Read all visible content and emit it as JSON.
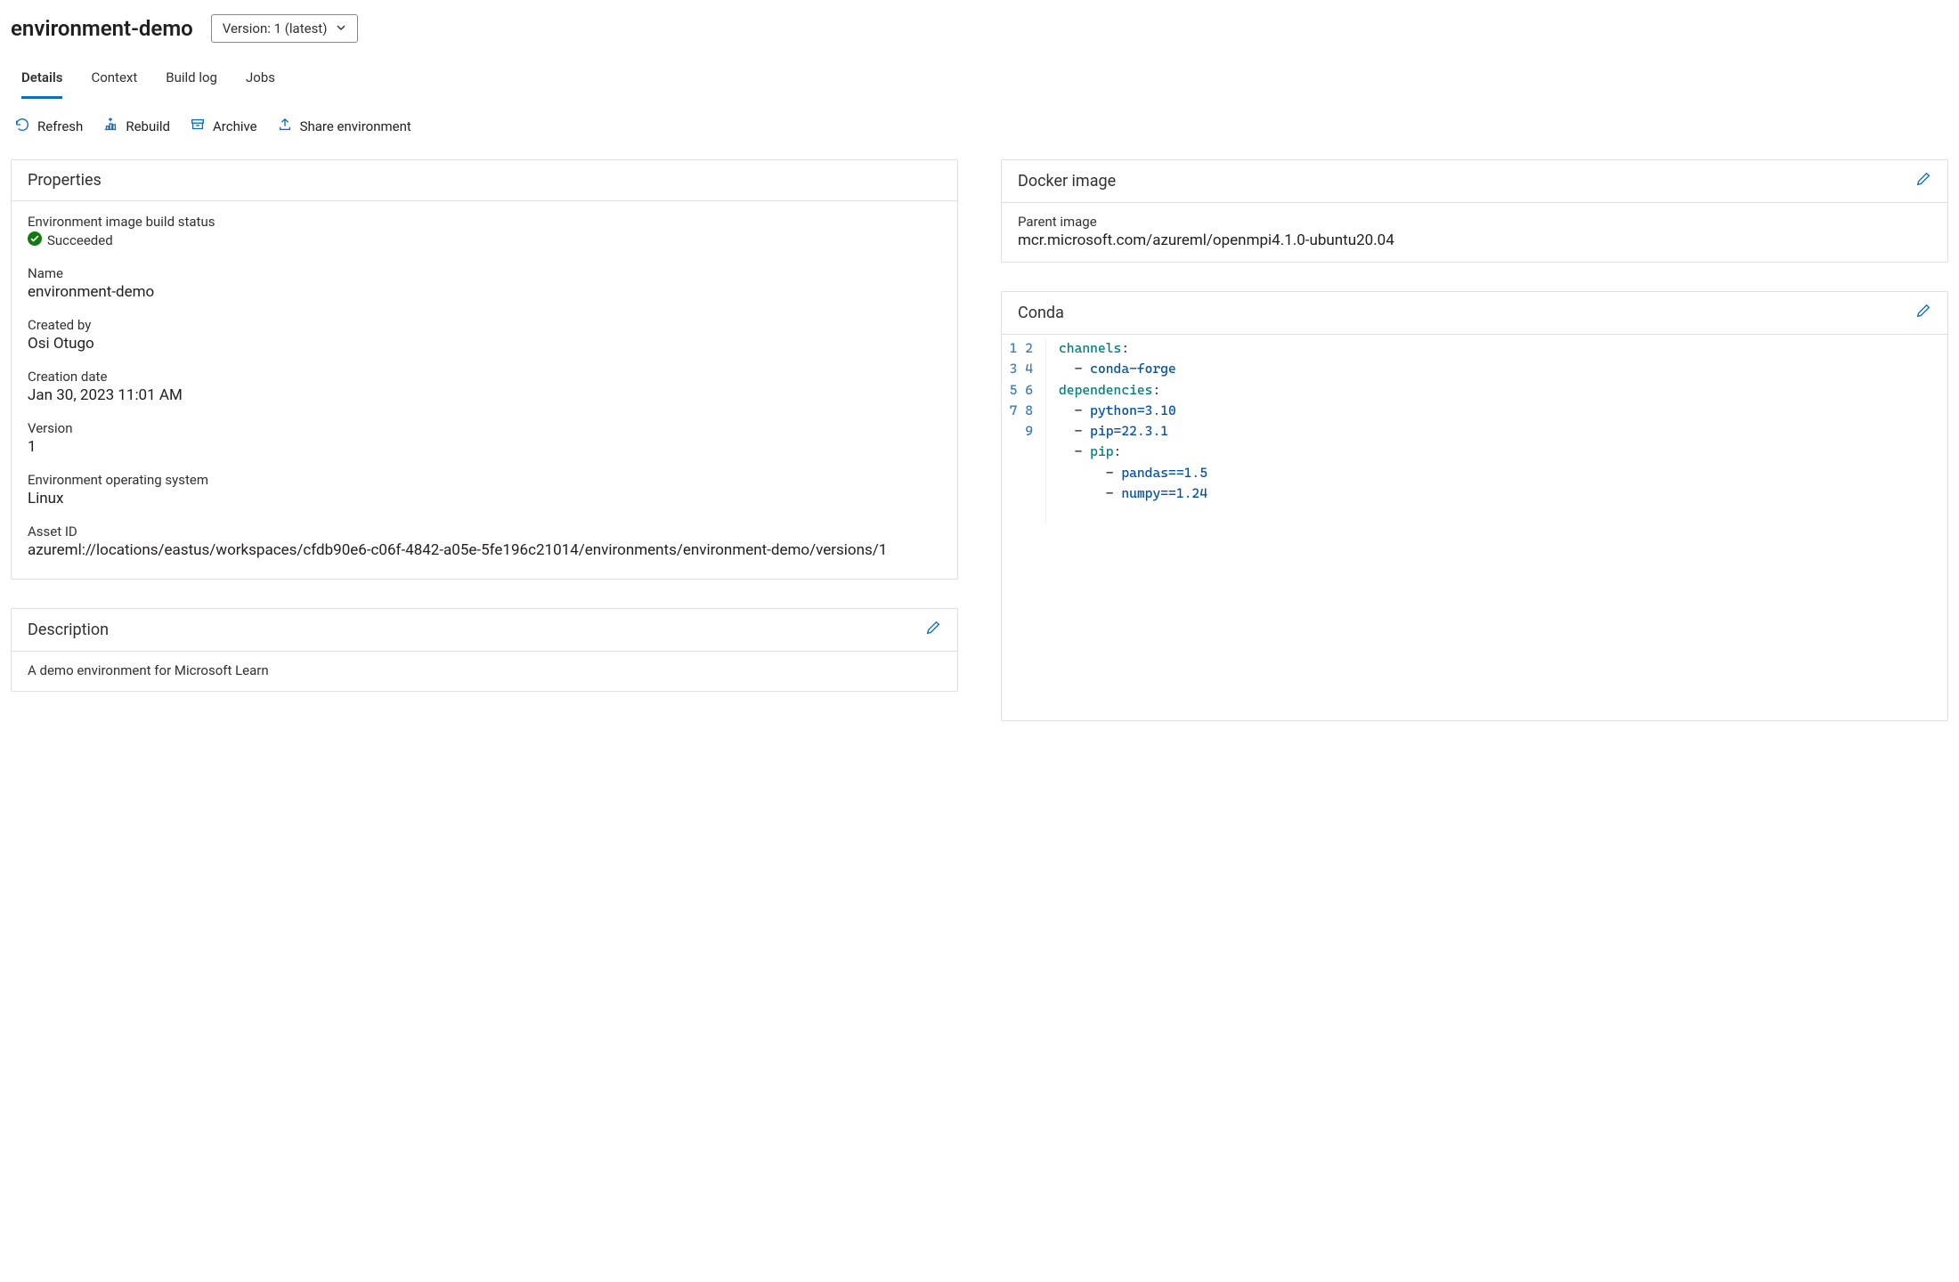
{
  "header": {
    "title": "environment-demo",
    "version_selector": "Version: 1 (latest)"
  },
  "tabs": [
    {
      "id": "details",
      "label": "Details",
      "active": true
    },
    {
      "id": "context",
      "label": "Context",
      "active": false
    },
    {
      "id": "buildlog",
      "label": "Build log",
      "active": false
    },
    {
      "id": "jobs",
      "label": "Jobs",
      "active": false
    }
  ],
  "toolbar": {
    "refresh": "Refresh",
    "rebuild": "Rebuild",
    "archive": "Archive",
    "share": "Share environment"
  },
  "properties": {
    "card_title": "Properties",
    "build_status_label": "Environment image build status",
    "build_status_value": "Succeeded",
    "name_label": "Name",
    "name_value": "environment-demo",
    "created_by_label": "Created by",
    "created_by_value": "Osi Otugo",
    "creation_date_label": "Creation date",
    "creation_date_value": "Jan 30, 2023 11:01 AM",
    "version_label": "Version",
    "version_value": "1",
    "os_label": "Environment operating system",
    "os_value": "Linux",
    "asset_id_label": "Asset ID",
    "asset_id_value": "azureml://locations/eastus/workspaces/cfdb90e6-c06f-4842-a05e-5fe196c21014/environments/environment-demo/versions/1"
  },
  "description": {
    "card_title": "Description",
    "text": "A demo environment for Microsoft Learn"
  },
  "docker": {
    "card_title": "Docker image",
    "parent_image_label": "Parent image",
    "parent_image_value": "mcr.microsoft.com/azureml/openmpi4.1.0-ubuntu20.04"
  },
  "conda": {
    "card_title": "Conda",
    "lines": [
      {
        "n": "1",
        "indent": 0,
        "key": "channels",
        "colon": true
      },
      {
        "n": "2",
        "indent": 1,
        "dash": true,
        "val": "conda-forge"
      },
      {
        "n": "3",
        "indent": 0,
        "key": "dependencies",
        "colon": true
      },
      {
        "n": "4",
        "indent": 1,
        "dash": true,
        "val": "python=3.10"
      },
      {
        "n": "5",
        "indent": 1,
        "dash": true,
        "val": "pip=22.3.1"
      },
      {
        "n": "6",
        "indent": 1,
        "dash": true,
        "key": "pip",
        "colon": true
      },
      {
        "n": "7",
        "indent": 3,
        "dash": true,
        "val": "pandas==1.5"
      },
      {
        "n": "8",
        "indent": 3,
        "dash": true,
        "val": "numpy==1.24"
      },
      {
        "n": "9",
        "indent": 0
      }
    ]
  }
}
